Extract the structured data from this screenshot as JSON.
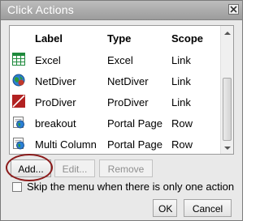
{
  "dialog": {
    "title": "Click Actions",
    "close_icon": "close-icon"
  },
  "table": {
    "columns": [
      "Label",
      "Type",
      "Scope"
    ],
    "rows": [
      {
        "icon": "spreadsheet-icon",
        "label": "Excel",
        "type": "Excel",
        "scope": "Link"
      },
      {
        "icon": "netdiver-icon",
        "label": "NetDiver",
        "type": "NetDiver",
        "scope": "Link"
      },
      {
        "icon": "prodiver-icon",
        "label": "ProDiver",
        "type": "ProDiver",
        "scope": "Link"
      },
      {
        "icon": "portal-page-icon",
        "label": "breakout",
        "type": "Portal Page",
        "scope": "Row"
      },
      {
        "icon": "portal-page-icon",
        "label": "Multi Column",
        "type": "Portal Page",
        "scope": "Row"
      }
    ]
  },
  "buttons": {
    "add": "Add...",
    "edit": "Edit...",
    "remove": "Remove",
    "ok": "OK",
    "cancel": "Cancel"
  },
  "options": {
    "skip_menu_label": "Skip the menu when there is only one action",
    "skip_menu_checked": false
  },
  "colors": {
    "titlebar": "#a9a9a9",
    "highlight_ring": "#8b1a1a",
    "excel_green": "#1e8a3c",
    "prodiver_red": "#b22222"
  }
}
